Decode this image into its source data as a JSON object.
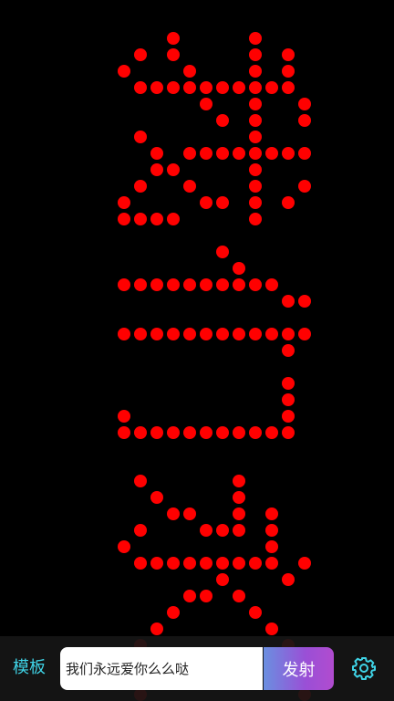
{
  "display": {
    "text_color": "#ff0000",
    "background_color": "#000000"
  },
  "toolbar": {
    "template_label": "模板",
    "message_value": "我们永远爱你么么哒",
    "send_label": "发射",
    "accent_color": "#3fd3e6",
    "send_gradient": [
      "#6a8fe0",
      "#b14ccf"
    ],
    "settings_icon": "gear-icon"
  }
}
